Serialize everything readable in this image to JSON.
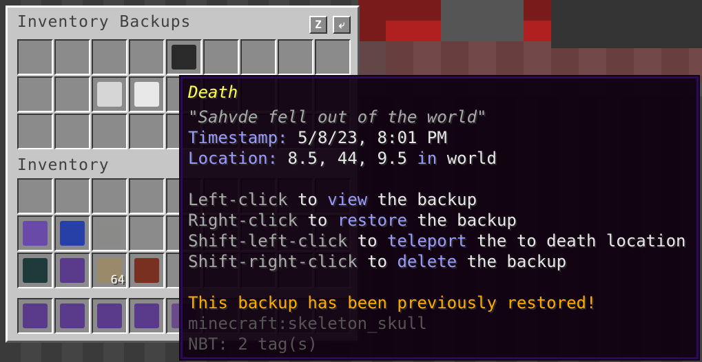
{
  "window": {
    "title": "Inventory Backups",
    "inventory_label": "Inventory",
    "buttons": [
      {
        "label": "Z",
        "icon": "sort-icon"
      },
      {
        "label": "⤶",
        "icon": "return-icon"
      }
    ]
  },
  "backup_slots": [
    {
      "row": 0,
      "col": 4,
      "icon": "wither-skeleton-skull-icon",
      "color": "#2a2a2a"
    },
    {
      "row": 1,
      "col": 2,
      "icon": "skeleton-skull-icon",
      "color": "#d6d6d6"
    },
    {
      "row": 1,
      "col": 3,
      "icon": "skeleton-skull-icon",
      "color": "#e8e8e8"
    }
  ],
  "inventory_slots": [
    {
      "row": 1,
      "col": 0,
      "icon": "netherite-chestplate-icon",
      "color": "#6a4aa8"
    },
    {
      "row": 1,
      "col": 1,
      "icon": "lapis-block-icon",
      "color": "#2740a8"
    },
    {
      "row": 1,
      "col": 2,
      "icon": "stone-block-icon",
      "color": "#8a8a88"
    },
    {
      "row": 2,
      "col": 0,
      "icon": "ender-chest-icon",
      "color": "#1e3a3a"
    },
    {
      "row": 2,
      "col": 1,
      "icon": "netherite-pickaxe-icon",
      "color": "#5a3a8a"
    },
    {
      "row": 2,
      "col": 2,
      "icon": "arrow-icon",
      "color": "#9a8a6a",
      "count": "64"
    },
    {
      "row": 2,
      "col": 3,
      "icon": "enchanted-book-icon",
      "color": "#7a3020"
    }
  ],
  "hotbar_slots": [
    {
      "col": 0,
      "icon": "netherite-sword-icon",
      "color": "#5a3a8a"
    },
    {
      "col": 1,
      "icon": "netherite-pickaxe-icon",
      "color": "#5a3a8a"
    },
    {
      "col": 2,
      "icon": "netherite-axe-icon",
      "color": "#5a3a8a"
    },
    {
      "col": 3,
      "icon": "netherite-shovel-icon",
      "color": "#5a3a8a"
    },
    {
      "col": 4,
      "icon": "bow-icon",
      "color": "#6a4a8a"
    }
  ],
  "tooltip": {
    "title": "Death",
    "quote": "\"Sahvde fell out of the world\"",
    "timestamp_label": "Timestamp:",
    "timestamp_value": "5/8/23, 8:01 PM",
    "location_label": "Location:",
    "location_value": "8.5, 44, 9.5",
    "location_in": "in",
    "location_world": "world",
    "actions": [
      {
        "trigger": "Left-click",
        "to": "to",
        "verb": "view",
        "rest": "the backup"
      },
      {
        "trigger": "Right-click",
        "to": "to",
        "verb": "restore",
        "rest": "the backup"
      },
      {
        "trigger": "Shift-left-click",
        "to": "to",
        "verb": "teleport",
        "rest": "the to death location"
      },
      {
        "trigger": "Shift-right-click",
        "to": "to",
        "verb": "delete",
        "rest": "the backup"
      }
    ],
    "warning": "This backup has been previously restored!",
    "item_id": "minecraft:skeleton_skull",
    "nbt": "NBT: 2 tag(s)",
    "hidden_count": "64"
  },
  "colors": {
    "title": "#ffff55",
    "label_blue": "#8a8aff",
    "warning": "#ffaa00",
    "gray": "#aaaaaa",
    "dim": "#555555"
  }
}
